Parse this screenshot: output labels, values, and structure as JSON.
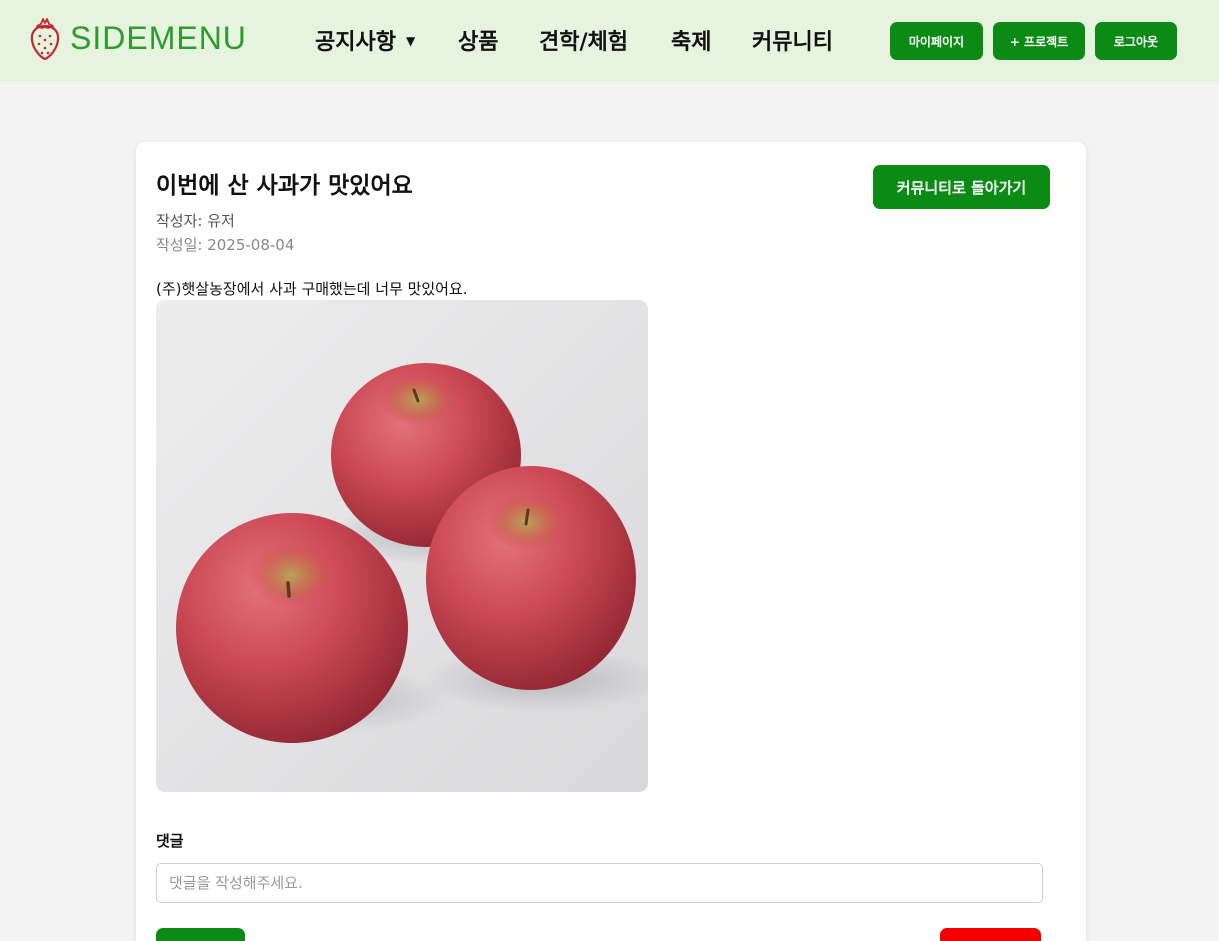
{
  "header": {
    "logo_text": "SIDEMENU",
    "nav": [
      {
        "label": "공지사항",
        "has_dropdown": true
      },
      {
        "label": "상품"
      },
      {
        "label": "견학/체험"
      },
      {
        "label": "축제"
      },
      {
        "label": "커뮤니티"
      }
    ],
    "buttons": {
      "mypage": "마이페이지",
      "project": "+ 프로젝트",
      "logout": "로그아웃"
    }
  },
  "post": {
    "title": "이번에 산 사과가 맛있어요",
    "author": "작성자: 유저",
    "date": "작성일: 2025-08-04",
    "body": "(주)햇살농장에서 사과 구매했는데 너무 맛있어요.",
    "back_button": "커뮤니티로 돌아가기",
    "image_icon": "apple-photo"
  },
  "comments": {
    "label": "댓글",
    "placeholder": "댓글을 작성해주세요.",
    "value": "",
    "submit_label": "",
    "delete_label": ""
  },
  "colors": {
    "header_bg": "#e6f3df",
    "accent": "#0b8a14",
    "logo": "#2e9b2e",
    "danger": "#f40000",
    "page_bg": "#f3f3f3"
  }
}
